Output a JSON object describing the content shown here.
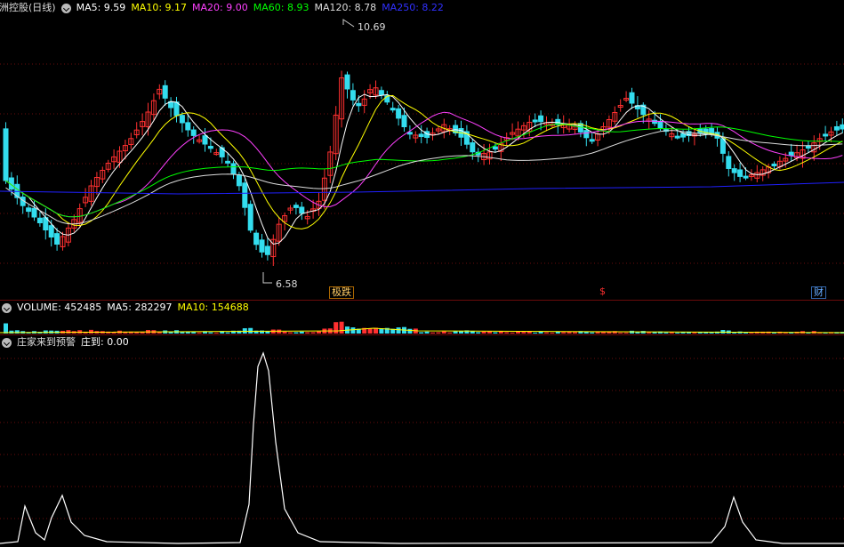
{
  "main_panel": {
    "title": "中洲控股(日线)",
    "indicators": [
      {
        "label": "MA5: 9.59",
        "color": "#ffffff"
      },
      {
        "label": "MA10: 9.17",
        "color": "#ffff00"
      },
      {
        "label": "MA20: 9.00",
        "color": "#ff40ff"
      },
      {
        "label": "MA60: 8.93",
        "color": "#00ff00"
      },
      {
        "label": "MA120: 8.78",
        "color": "#dddddd"
      },
      {
        "label": "MA250: 8.22",
        "color": "#2020ff"
      }
    ],
    "high_label": "10.69",
    "low_label": "6.58",
    "event_tags": [
      {
        "text": "极跌",
        "color": "#ffcc66"
      },
      {
        "text": "$",
        "color": "#ff3030"
      },
      {
        "text": "财",
        "color": "#66aaff"
      }
    ]
  },
  "volume_panel": {
    "indicators": [
      {
        "label": "VOLUME: 452485",
        "color": "#ffffff"
      },
      {
        "label": "MA5: 282297",
        "color": "#ffffff"
      },
      {
        "label": "MA10: 154688",
        "color": "#ffff00"
      }
    ]
  },
  "signal_panel": {
    "title": "庄家来到预警",
    "indicators": [
      {
        "label": "庄到: 0.00",
        "color": "#ffffff"
      }
    ]
  },
  "colors": {
    "up": "#ff3030",
    "down": "#33ddee",
    "grid": "#6a0b0b"
  }
}
